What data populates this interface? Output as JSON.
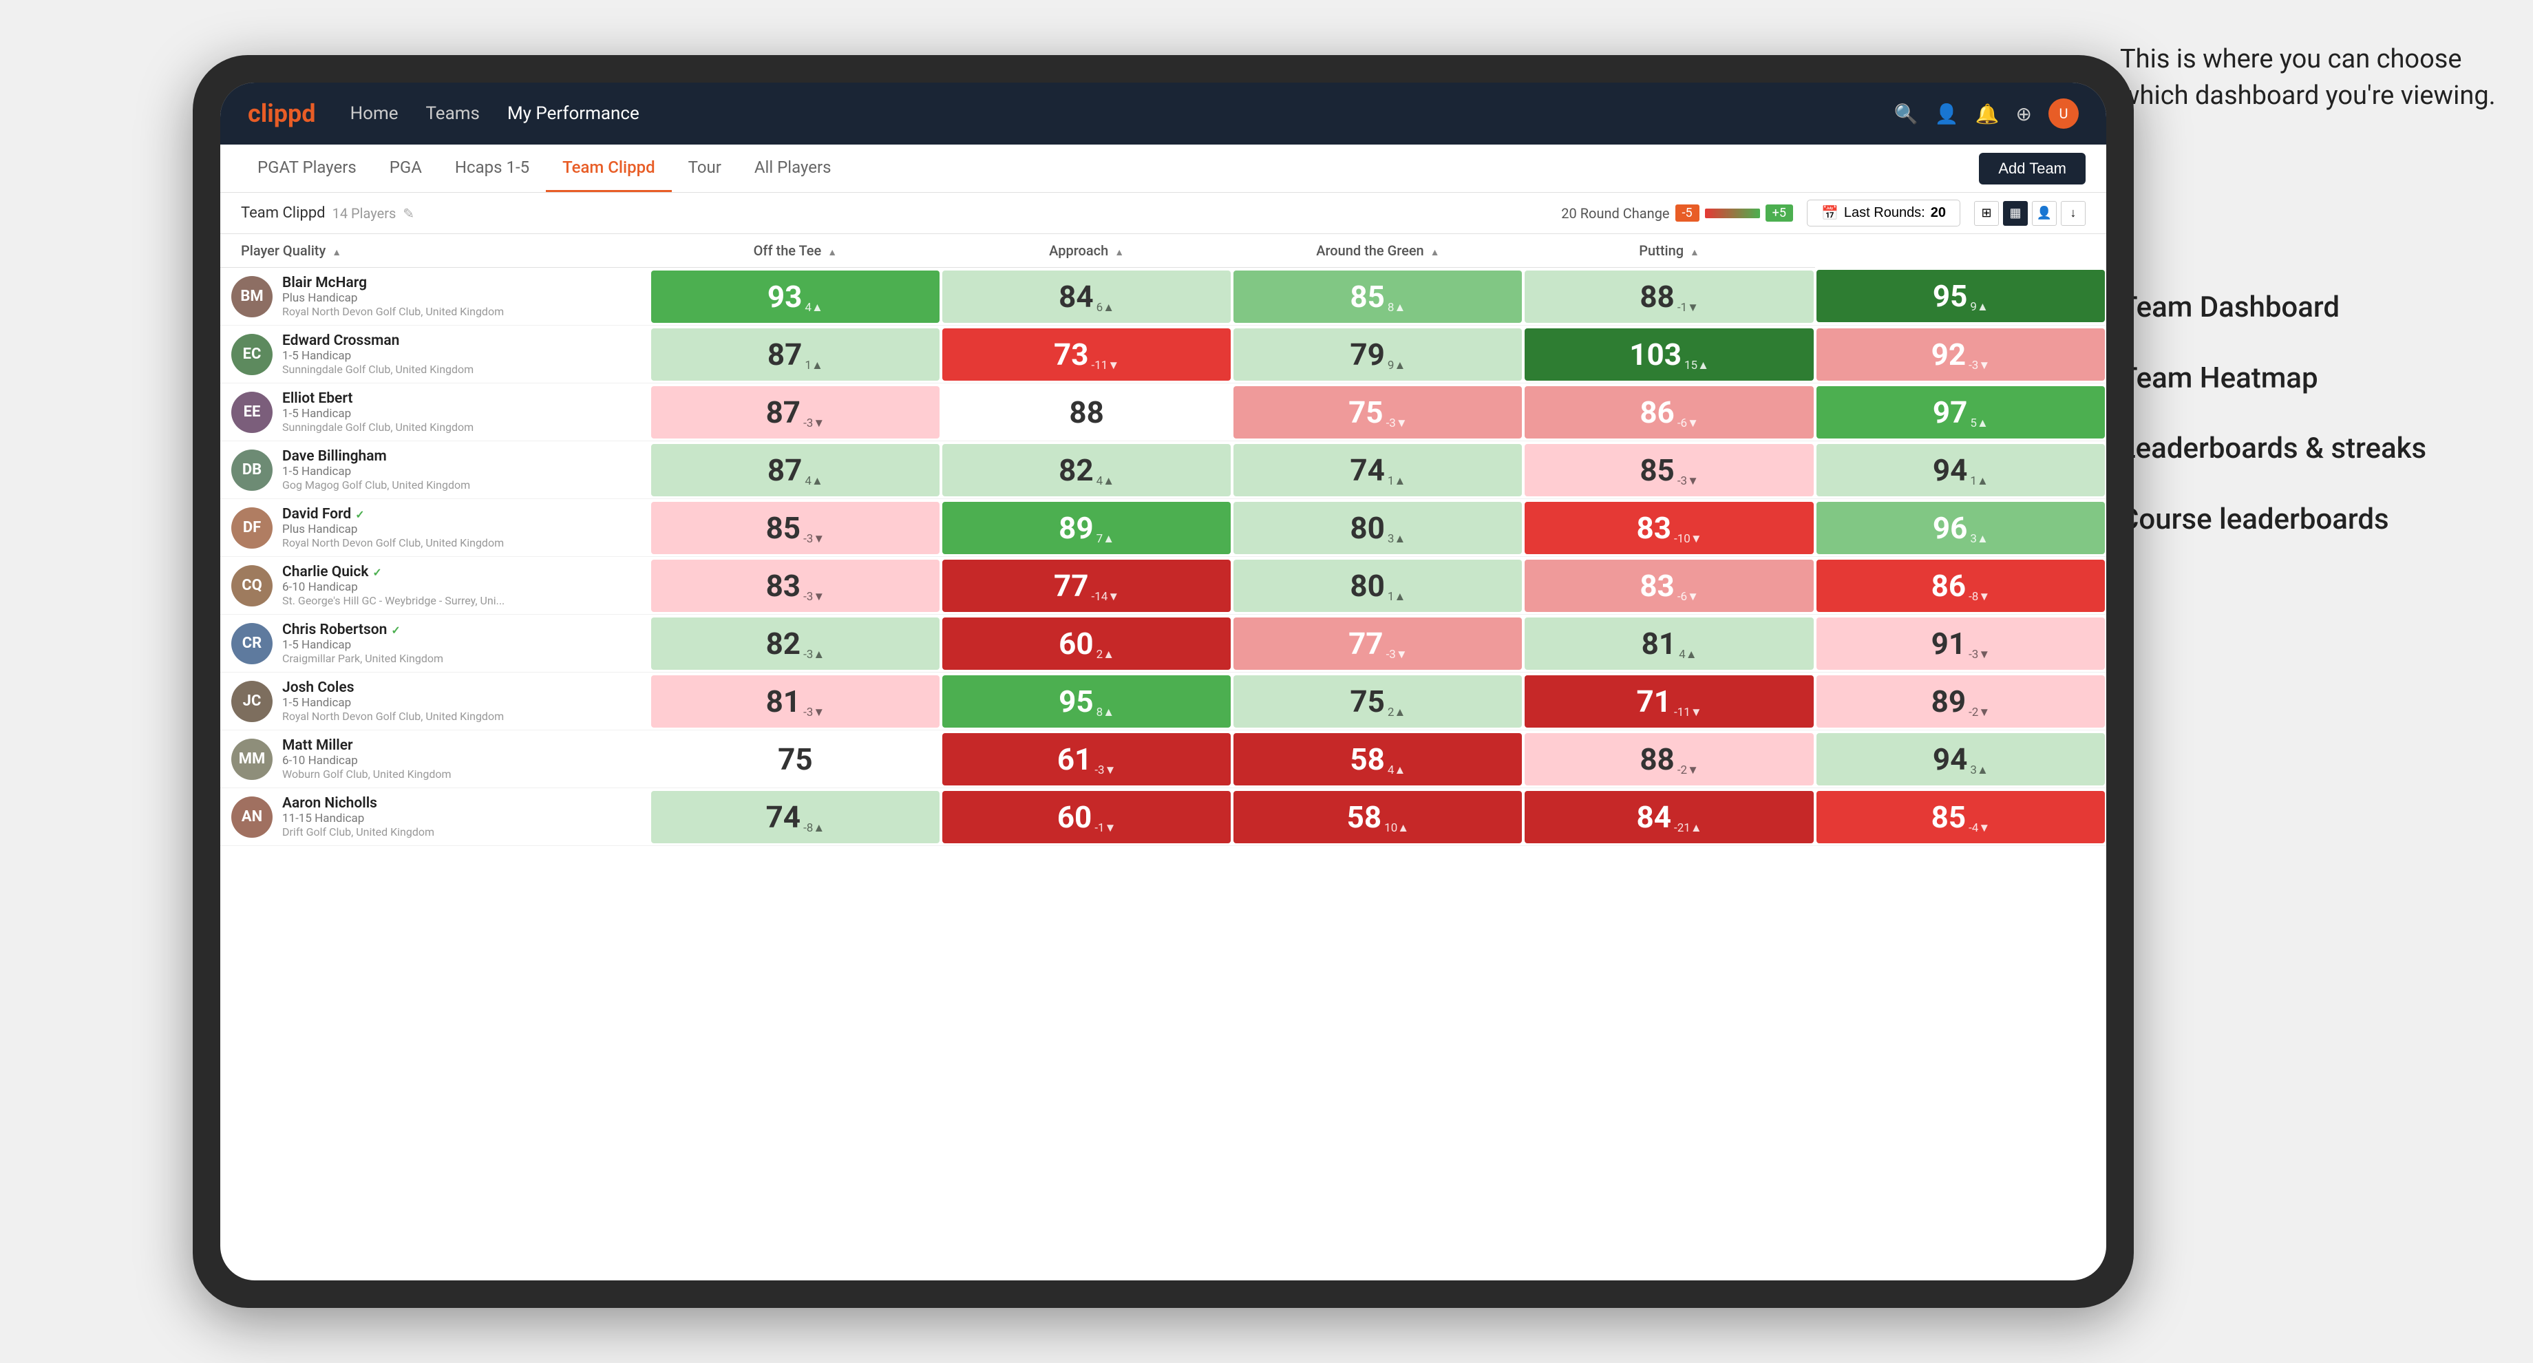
{
  "annotation": {
    "bubble_text": "This is where you can choose which dashboard you're viewing.",
    "options": [
      {
        "label": "Team Dashboard"
      },
      {
        "label": "Team Heatmap"
      },
      {
        "label": "Leaderboards & streaks"
      },
      {
        "label": "Course leaderboards"
      }
    ]
  },
  "nav": {
    "logo": "clippd",
    "links": [
      {
        "label": "Home",
        "active": false
      },
      {
        "label": "Teams",
        "active": false
      },
      {
        "label": "My Performance",
        "active": true
      }
    ],
    "icons": [
      "🔍",
      "👤",
      "🔔",
      "⊕"
    ]
  },
  "sub_nav": {
    "links": [
      {
        "label": "PGAT Players",
        "active": false
      },
      {
        "label": "PGA",
        "active": false
      },
      {
        "label": "Hcaps 1-5",
        "active": false
      },
      {
        "label": "Team Clippd",
        "active": true
      },
      {
        "label": "Tour",
        "active": false
      },
      {
        "label": "All Players",
        "active": false
      }
    ],
    "add_team_label": "Add Team"
  },
  "team_bar": {
    "team_label": "Team Clippd",
    "player_count": "14 Players",
    "round_change_label": "20 Round Change",
    "neg_value": "-5",
    "pos_value": "+5",
    "last_rounds_label": "Last Rounds:",
    "last_rounds_value": "20"
  },
  "table": {
    "headers": [
      {
        "label": "Player Quality",
        "sortable": true
      },
      {
        "label": "Off the Tee",
        "sortable": true
      },
      {
        "label": "Approach",
        "sortable": true
      },
      {
        "label": "Around the Green",
        "sortable": true
      },
      {
        "label": "Putting",
        "sortable": true
      }
    ],
    "players": [
      {
        "name": "Blair McHarg",
        "handicap": "Plus Handicap",
        "club": "Royal North Devon Golf Club, United Kingdom",
        "avatar_color": "#8d6e63",
        "initials": "BM",
        "scores": [
          {
            "value": "93",
            "delta": "4▲",
            "color": "bg-green-mid"
          },
          {
            "value": "84",
            "delta": "6▲",
            "color": "bg-green-pale"
          },
          {
            "value": "85",
            "delta": "8▲",
            "color": "bg-green-light"
          },
          {
            "value": "88",
            "delta": "-1▼",
            "color": "bg-green-pale"
          },
          {
            "value": "95",
            "delta": "9▲",
            "color": "bg-green-dark"
          }
        ]
      },
      {
        "name": "Edward Crossman",
        "handicap": "1-5 Handicap",
        "club": "Sunningdale Golf Club, United Kingdom",
        "avatar_color": "#5d8a5e",
        "initials": "EC",
        "scores": [
          {
            "value": "87",
            "delta": "1▲",
            "color": "bg-green-pale"
          },
          {
            "value": "73",
            "delta": "-11▼",
            "color": "bg-red-mid"
          },
          {
            "value": "79",
            "delta": "9▲",
            "color": "bg-green-pale"
          },
          {
            "value": "103",
            "delta": "15▲",
            "color": "bg-green-dark"
          },
          {
            "value": "92",
            "delta": "-3▼",
            "color": "bg-red-light"
          }
        ]
      },
      {
        "name": "Elliot Ebert",
        "handicap": "1-5 Handicap",
        "club": "Sunningdale Golf Club, United Kingdom",
        "avatar_color": "#7b5e7b",
        "initials": "EE",
        "scores": [
          {
            "value": "87",
            "delta": "-3▼",
            "color": "bg-red-pale"
          },
          {
            "value": "88",
            "delta": "",
            "color": "bg-white"
          },
          {
            "value": "75",
            "delta": "-3▼",
            "color": "bg-red-light"
          },
          {
            "value": "86",
            "delta": "-6▼",
            "color": "bg-red-light"
          },
          {
            "value": "97",
            "delta": "5▲",
            "color": "bg-green-mid"
          }
        ]
      },
      {
        "name": "Dave Billingham",
        "handicap": "1-5 Handicap",
        "club": "Gog Magog Golf Club, United Kingdom",
        "avatar_color": "#6d8b74",
        "initials": "DB",
        "scores": [
          {
            "value": "87",
            "delta": "4▲",
            "color": "bg-green-pale"
          },
          {
            "value": "82",
            "delta": "4▲",
            "color": "bg-green-pale"
          },
          {
            "value": "74",
            "delta": "1▲",
            "color": "bg-green-pale"
          },
          {
            "value": "85",
            "delta": "-3▼",
            "color": "bg-red-pale"
          },
          {
            "value": "94",
            "delta": "1▲",
            "color": "bg-green-pale"
          }
        ]
      },
      {
        "name": "David Ford",
        "handicap": "Plus Handicap",
        "club": "Royal North Devon Golf Club, United Kingdom",
        "avatar_color": "#b07d62",
        "initials": "DF",
        "verified": true,
        "scores": [
          {
            "value": "85",
            "delta": "-3▼",
            "color": "bg-red-pale"
          },
          {
            "value": "89",
            "delta": "7▲",
            "color": "bg-green-mid"
          },
          {
            "value": "80",
            "delta": "3▲",
            "color": "bg-green-pale"
          },
          {
            "value": "83",
            "delta": "-10▼",
            "color": "bg-red-mid"
          },
          {
            "value": "96",
            "delta": "3▲",
            "color": "bg-green-light"
          }
        ]
      },
      {
        "name": "Charlie Quick",
        "handicap": "6-10 Handicap",
        "club": "St. George's Hill GC - Weybridge - Surrey, Uni...",
        "avatar_color": "#9e7b5e",
        "initials": "CQ",
        "verified": true,
        "scores": [
          {
            "value": "83",
            "delta": "-3▼",
            "color": "bg-red-pale"
          },
          {
            "value": "77",
            "delta": "-14▼",
            "color": "bg-red-dark"
          },
          {
            "value": "80",
            "delta": "1▲",
            "color": "bg-green-pale"
          },
          {
            "value": "83",
            "delta": "-6▼",
            "color": "bg-red-light"
          },
          {
            "value": "86",
            "delta": "-8▼",
            "color": "bg-red-mid"
          }
        ]
      },
      {
        "name": "Chris Robertson",
        "handicap": "1-5 Handicap",
        "club": "Craigmillar Park, United Kingdom",
        "avatar_color": "#5e7a9e",
        "initials": "CR",
        "verified": true,
        "scores": [
          {
            "value": "82",
            "delta": "-3▲",
            "color": "bg-green-pale"
          },
          {
            "value": "60",
            "delta": "2▲",
            "color": "bg-red-dark"
          },
          {
            "value": "77",
            "delta": "-3▼",
            "color": "bg-red-light"
          },
          {
            "value": "81",
            "delta": "4▲",
            "color": "bg-green-pale"
          },
          {
            "value": "91",
            "delta": "-3▼",
            "color": "bg-red-pale"
          }
        ]
      },
      {
        "name": "Josh Coles",
        "handicap": "1-5 Handicap",
        "club": "Royal North Devon Golf Club, United Kingdom",
        "avatar_color": "#7d6e5e",
        "initials": "JC",
        "scores": [
          {
            "value": "81",
            "delta": "-3▼",
            "color": "bg-red-pale"
          },
          {
            "value": "95",
            "delta": "8▲",
            "color": "bg-green-mid"
          },
          {
            "value": "75",
            "delta": "2▲",
            "color": "bg-green-pale"
          },
          {
            "value": "71",
            "delta": "-11▼",
            "color": "bg-red-dark"
          },
          {
            "value": "89",
            "delta": "-2▼",
            "color": "bg-red-pale"
          }
        ]
      },
      {
        "name": "Matt Miller",
        "handicap": "6-10 Handicap",
        "club": "Woburn Golf Club, United Kingdom",
        "avatar_color": "#8e8e7a",
        "initials": "MM",
        "scores": [
          {
            "value": "75",
            "delta": "",
            "color": "bg-white"
          },
          {
            "value": "61",
            "delta": "-3▼",
            "color": "bg-red-dark"
          },
          {
            "value": "58",
            "delta": "4▲",
            "color": "bg-red-dark"
          },
          {
            "value": "88",
            "delta": "-2▼",
            "color": "bg-red-pale"
          },
          {
            "value": "94",
            "delta": "3▲",
            "color": "bg-green-pale"
          }
        ]
      },
      {
        "name": "Aaron Nicholls",
        "handicap": "11-15 Handicap",
        "club": "Drift Golf Club, United Kingdom",
        "avatar_color": "#a07060",
        "initials": "AN",
        "scores": [
          {
            "value": "74",
            "delta": "-8▲",
            "color": "bg-green-pale"
          },
          {
            "value": "60",
            "delta": "-1▼",
            "color": "bg-red-dark"
          },
          {
            "value": "58",
            "delta": "10▲",
            "color": "bg-red-dark"
          },
          {
            "value": "84",
            "delta": "-21▲",
            "color": "bg-red-dark"
          },
          {
            "value": "85",
            "delta": "-4▼",
            "color": "bg-red-mid"
          }
        ]
      }
    ]
  }
}
